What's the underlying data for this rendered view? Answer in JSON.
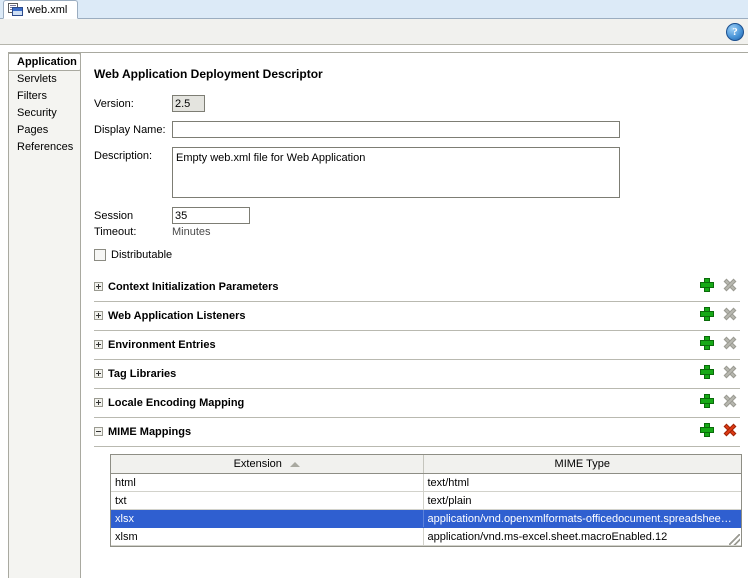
{
  "tab": {
    "label": "web.xml",
    "icon": "xml-file-icon"
  },
  "toolbar": {
    "help_label": "?",
    "help_icon": "help-circle-icon"
  },
  "nav": {
    "items": [
      {
        "label": "Application",
        "selected": true
      },
      {
        "label": "Servlets",
        "selected": false
      },
      {
        "label": "Filters",
        "selected": false
      },
      {
        "label": "Security",
        "selected": false
      },
      {
        "label": "Pages",
        "selected": false
      },
      {
        "label": "References",
        "selected": false
      }
    ]
  },
  "main": {
    "title": "Web Application Deployment Descriptor",
    "fields": {
      "version": {
        "label": "Version:",
        "value": "2.5"
      },
      "display_name": {
        "label": "Display Name:",
        "value": ""
      },
      "description": {
        "label": "Description:",
        "value": "Empty web.xml file for Web Application"
      },
      "session_timeout": {
        "label": "Session Timeout:",
        "value": "35",
        "hint": "Minutes"
      },
      "distributable": {
        "label": "Distributable",
        "checked": false
      }
    }
  },
  "sections": [
    {
      "title": "Context Initialization Parameters",
      "expanded": false,
      "delete_enabled": false
    },
    {
      "title": "Web Application Listeners",
      "expanded": false,
      "delete_enabled": false
    },
    {
      "title": "Environment Entries",
      "expanded": false,
      "delete_enabled": false
    },
    {
      "title": "Tag Libraries",
      "expanded": false,
      "delete_enabled": false
    },
    {
      "title": "Locale Encoding Mapping",
      "expanded": false,
      "delete_enabled": false
    },
    {
      "title": "MIME Mappings",
      "expanded": true,
      "delete_enabled": true
    }
  ],
  "mime_table": {
    "columns": [
      "Extension",
      "MIME Type"
    ],
    "sort_column": "Extension",
    "sort_direction": "ascending",
    "rows": [
      {
        "extension": "html",
        "mime_type": "text/html",
        "selected": false
      },
      {
        "extension": "txt",
        "mime_type": "text/plain",
        "selected": false
      },
      {
        "extension": "xlsx",
        "mime_type": "application/vnd.openxmlformats-officedocument.spreadshee…",
        "selected": true
      },
      {
        "extension": "xlsm",
        "mime_type": "application/vnd.ms-excel.sheet.macroEnabled.12",
        "selected": false
      }
    ]
  },
  "colors": {
    "selection_blue": "#2f5fd0",
    "add_green": "#16a916",
    "delete_red": "#e23a14",
    "delete_disabled": "#b8b8b0"
  }
}
